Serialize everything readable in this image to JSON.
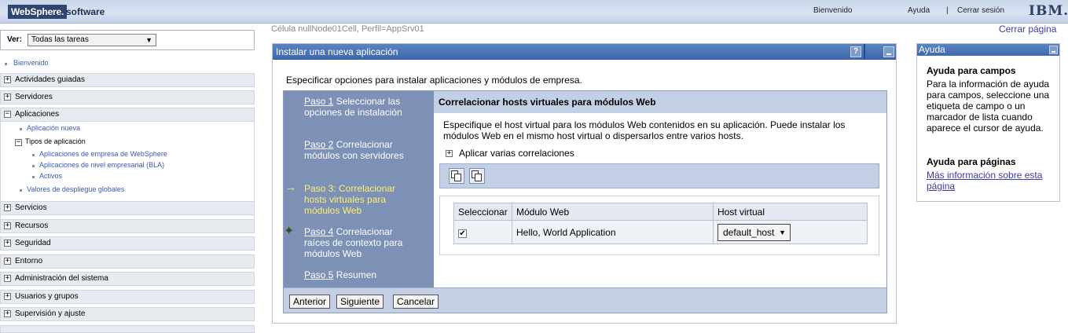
{
  "banner": {
    "brand": "WebSphere.",
    "brand_sub": "software",
    "welcome": "Bienvenido",
    "help": "Ayuda",
    "sep": "|",
    "logout": "Cerrar sesión",
    "logo": "IBM."
  },
  "nav": {
    "view_label": "Ver:",
    "view_value": "Todas las tareas",
    "welcome_link": "Bienvenido",
    "sections": [
      "Actividades guiadas",
      "Servidores",
      "Aplicaciones",
      "Servicios",
      "Recursos",
      "Seguridad",
      "Entorno",
      "Administración del sistema",
      "Usuarios y grupos",
      "Supervisión y ajuste"
    ],
    "apps": {
      "new_app": "Aplicación nueva",
      "types_label": "Tipos de aplicación",
      "types": [
        "Aplicaciones de empresa de WebSphere",
        "Aplicaciones de nivel empresarial (BLA)",
        "Activos"
      ],
      "deploy_values": "Valores de despliegue globales"
    }
  },
  "cell_info": "Célula nullNode01Cell, Perfil=AppSrv01",
  "close_page": "Cerrar página",
  "portlet": {
    "title": "Instalar una nueva aplicación",
    "help_btn": "?",
    "intro": "Especificar opciones para instalar aplicaciones y módulos de empresa.",
    "steps": [
      {
        "link": "Paso 1",
        "text": " Seleccionar las opciones de instalación"
      },
      {
        "link": "Paso 2",
        "text": " Correlacionar módulos con servidores"
      },
      {
        "link": "",
        "text": "Paso 3: Correlacionar hosts virtuales para módulos Web"
      },
      {
        "link": "Paso 4",
        "text": " Correlacionar raíces de contexto para módulos Web"
      },
      {
        "link": "Paso 5",
        "text": " Resumen"
      }
    ],
    "step_heading": "Correlacionar hosts virtuales para módulos Web",
    "step_desc": "Especifique el host virtual para los módulos Web contenidos en su aplicación. Puede instalar los módulos Web en el mismo host virtual o dispersarlos entre varios hosts.",
    "multi_map": "Aplicar varias correlaciones",
    "table": {
      "headers": [
        "Seleccionar",
        "Módulo Web",
        "Host virtual"
      ],
      "rows": [
        {
          "checked": "✔",
          "module": "Hello, World Application",
          "host": "default_host"
        }
      ]
    },
    "buttons": {
      "previous": "Anterior",
      "next": "Siguiente",
      "cancel": "Cancelar"
    }
  },
  "help": {
    "title": "Ayuda",
    "fields_heading": "Ayuda para campos",
    "fields_text": "Para la información de ayuda para campos, seleccione una etiqueta de campo o un marcador de lista cuando aparece el cursor de ayuda.",
    "pages_heading": "Ayuda para páginas",
    "pages_link": "Más información sobre esta página"
  }
}
